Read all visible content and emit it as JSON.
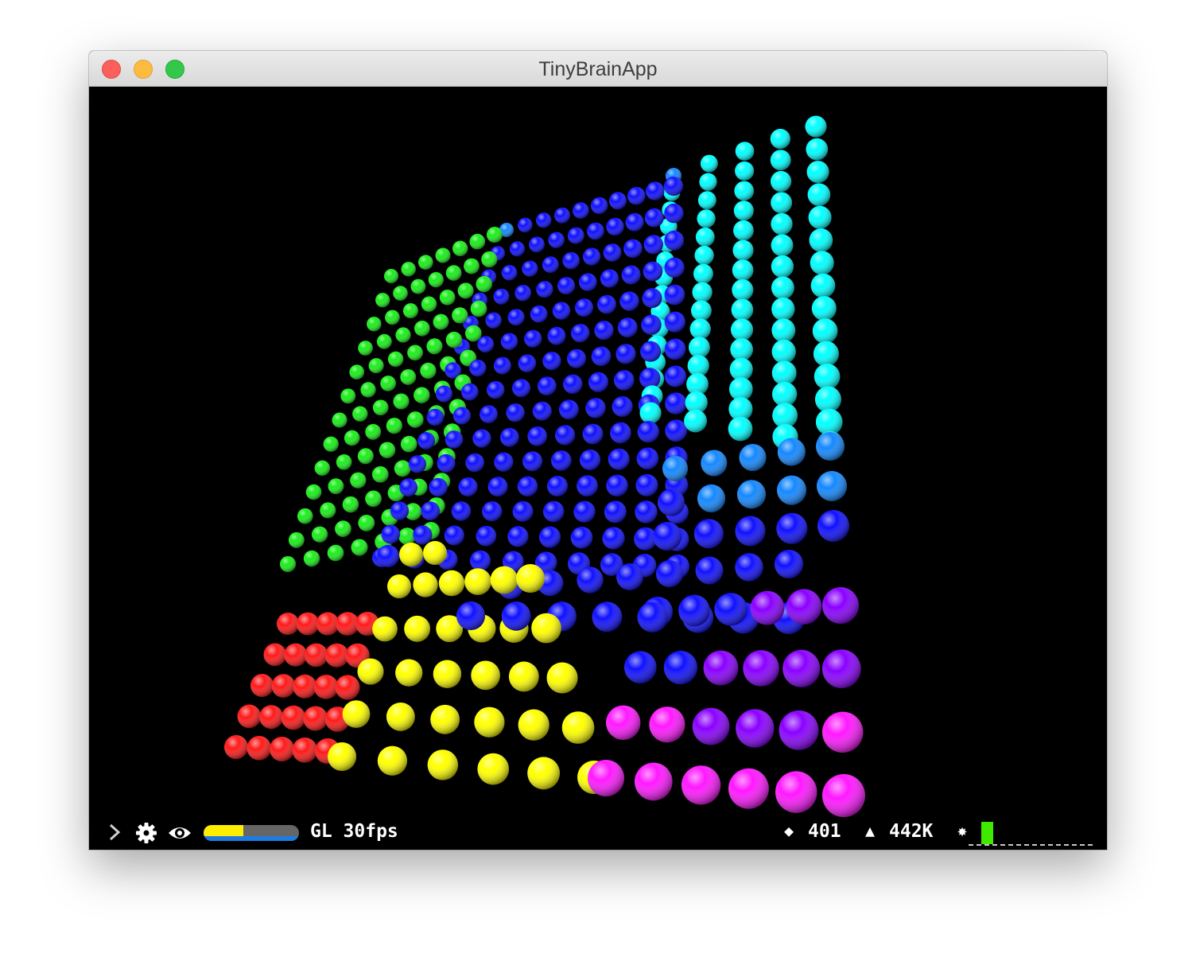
{
  "window": {
    "title": "TinyBrainApp"
  },
  "status_bar": {
    "gl_label": "GL 30fps",
    "perf_meter_fill": 0.42,
    "vertex_count": "401",
    "triangle_count": "442K",
    "command_input_value": ""
  },
  "colors": {
    "red": "#ff1a1a",
    "yellow": "#ffff00",
    "green": "#19ee19",
    "blue": "#1010ff",
    "cyan": "#00ffff",
    "magenta": "#ff18ff",
    "violet": "#8a00ff",
    "sky": "#1488ff",
    "cursor": "#3fea00",
    "perf_yellow": "#ffee00",
    "perf_blue": "#1e7be0"
  },
  "icons": {
    "expand": "chevron-right-icon",
    "settings": "gear-icon",
    "visibility": "eye-icon",
    "vertices": "diamond-icon",
    "triangles": "triangle-icon",
    "command": "asterisk-icon"
  }
}
